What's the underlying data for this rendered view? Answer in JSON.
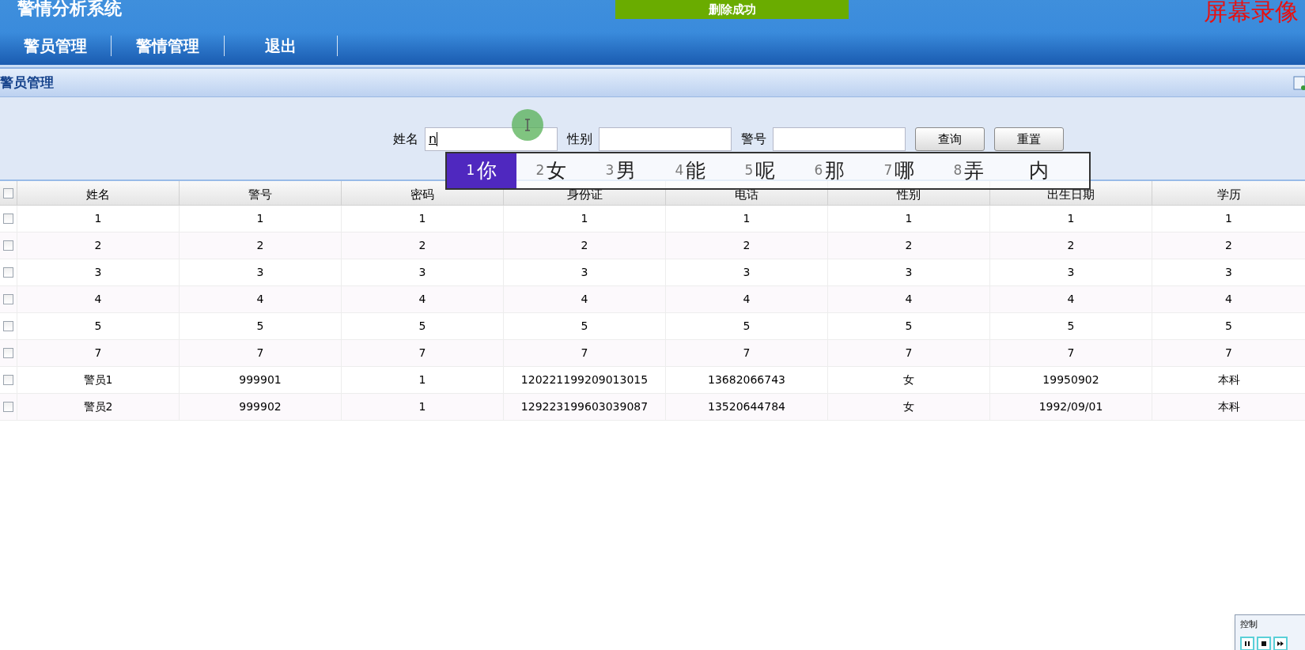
{
  "app_title": "警情分析系统",
  "toast": "删除成功",
  "recorder_label": "屏幕录像",
  "nav": [
    {
      "label": "警员管理"
    },
    {
      "label": "警情管理"
    },
    {
      "label": "退出"
    }
  ],
  "panel": {
    "title": "警员管理"
  },
  "search": {
    "fields": [
      {
        "label": "姓名",
        "value": "n"
      },
      {
        "label": "性别"
      },
      {
        "label": "警号"
      }
    ],
    "buttons": [
      "查询",
      "重置"
    ]
  },
  "ime": {
    "candidates": [
      {
        "num": "1",
        "char": "你",
        "selected": true
      },
      {
        "num": "2",
        "char": "女",
        "selected": false
      },
      {
        "num": "3",
        "char": "男",
        "selected": false
      },
      {
        "num": "4",
        "char": "能",
        "selected": false
      },
      {
        "num": "5",
        "char": "呢",
        "selected": false
      },
      {
        "num": "6",
        "char": "那",
        "selected": false
      },
      {
        "num": "7",
        "char": "哪",
        "selected": false
      },
      {
        "num": "8",
        "char": "弄",
        "selected": false
      },
      {
        "char": "内",
        "selected": false
      }
    ]
  },
  "table": {
    "all_checked": false,
    "columns": [
      "姓名",
      "警号",
      "密码",
      "身份证",
      "电话",
      "性别",
      "出生日期",
      "学历"
    ],
    "rows": [
      {
        "checked": false,
        "cells": [
          "1",
          "1",
          "1",
          "1",
          "1",
          "1",
          "1",
          "1"
        ]
      },
      {
        "checked": false,
        "cells": [
          "2",
          "2",
          "2",
          "2",
          "2",
          "2",
          "2",
          "2"
        ]
      },
      {
        "checked": false,
        "cells": [
          "3",
          "3",
          "3",
          "3",
          "3",
          "3",
          "3",
          "3"
        ]
      },
      {
        "checked": false,
        "cells": [
          "4",
          "4",
          "4",
          "4",
          "4",
          "4",
          "4",
          "4"
        ]
      },
      {
        "checked": false,
        "cells": [
          "5",
          "5",
          "5",
          "5",
          "5",
          "5",
          "5",
          "5"
        ]
      },
      {
        "checked": false,
        "cells": [
          "7",
          "7",
          "7",
          "7",
          "7",
          "7",
          "7",
          "7"
        ]
      },
      {
        "checked": false,
        "cells": [
          "警员1",
          "999901",
          "1",
          "120221199209013015",
          "13682066743",
          "女",
          "19950902",
          "本科"
        ]
      },
      {
        "checked": false,
        "cells": [
          "警员2",
          "999902",
          "1",
          "129223199603039087",
          "13520644784",
          "女",
          "1992/09/01",
          "本科"
        ]
      }
    ]
  },
  "control_window": {
    "title": "控制"
  }
}
